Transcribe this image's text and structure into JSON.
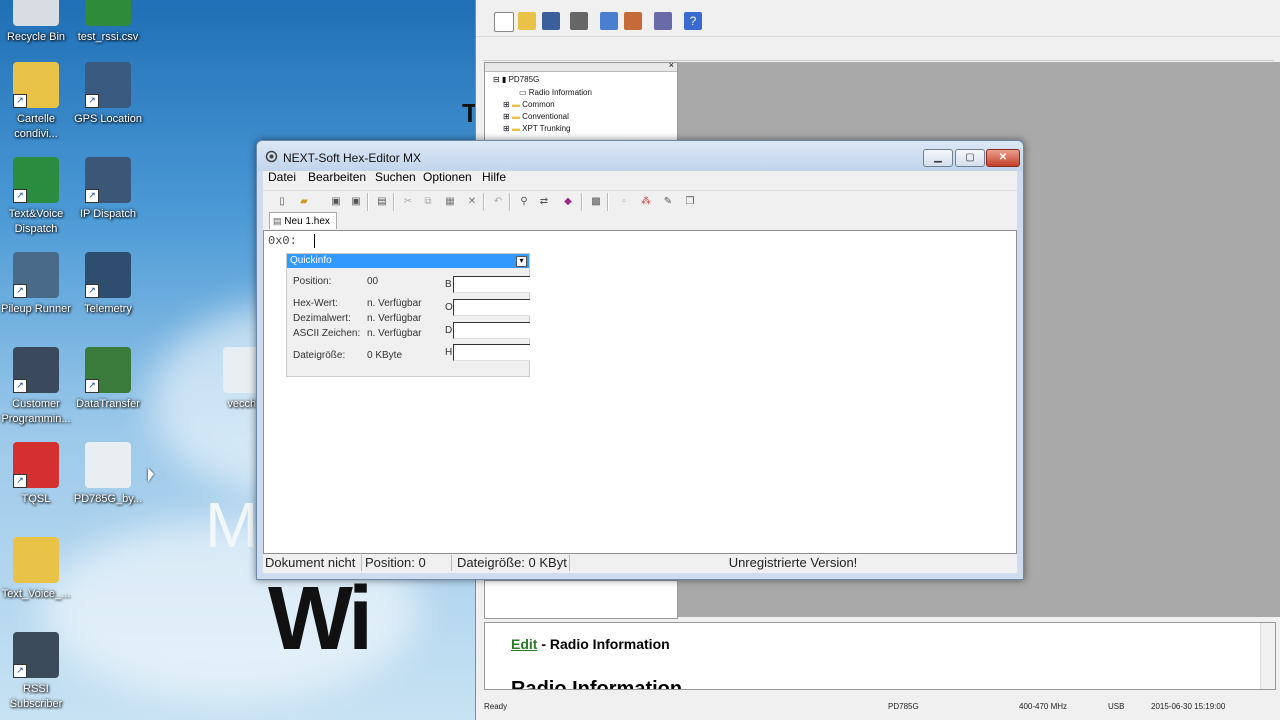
{
  "desktop": {
    "icons": [
      {
        "label": "Recycle Bin",
        "shortcut": false,
        "color": "#d8dde3"
      },
      {
        "label": "test_rssi.csv",
        "shortcut": false,
        "color": "#2e8b3a"
      },
      {
        "label": "Cartelle condivi...",
        "shortcut": true,
        "color": "#e9c347"
      },
      {
        "label": "GPS Location",
        "shortcut": true,
        "color": "#3a5a80"
      },
      {
        "label": "Text&Voice Dispatch",
        "shortcut": true,
        "color": "#2a8c3e"
      },
      {
        "label": "IP Dispatch",
        "shortcut": true,
        "color": "#3b5676"
      },
      {
        "label": "Pileup Runner",
        "shortcut": true,
        "color": "#4a6a8a"
      },
      {
        "label": "Telemetry",
        "shortcut": true,
        "color": "#2f4e6f"
      },
      {
        "label": "Customer Programmin...",
        "shortcut": true,
        "color": "#3a4a5c"
      },
      {
        "label": "DataTransfer",
        "shortcut": true,
        "color": "#3a7a3a"
      },
      {
        "label": "TQSL",
        "shortcut": true,
        "color": "#d43030"
      },
      {
        "label": "PD785G_by...",
        "shortcut": false,
        "color": "#e8eef2"
      },
      {
        "label": "Text_Voice_...",
        "shortcut": false,
        "color": "#e9c347"
      },
      {
        "label": "RSSI Subscriber",
        "shortcut": true,
        "color": "#3b4b5c"
      },
      {
        "label": "vecchia",
        "shortcut": false,
        "color": "#e8eef2"
      }
    ]
  },
  "back_app": {
    "tree": {
      "root": "PD785G",
      "items": [
        "Radio Information",
        "Common",
        "Conventional",
        "XPT Trunking"
      ]
    },
    "doc": {
      "link": "Edit",
      "heading_suffix": " - Radio Information",
      "big_heading": "Radio Information"
    },
    "status": {
      "ready": "Ready",
      "model": "PD785G",
      "band": "400-470 MHz",
      "port": "USB",
      "datetime": "2015-06-30 15:19:00"
    }
  },
  "hex_editor": {
    "title": "NEXT-Soft Hex-Editor MX",
    "menu": [
      "Datei",
      "Bearbeiten",
      "Suchen",
      "Optionen",
      "Hilfe"
    ],
    "tab": "Neu 1.hex",
    "address": "0x0:",
    "quickinfo": {
      "title": "Quickinfo",
      "position_label": "Position:",
      "position_value": "00",
      "hex_label": "Hex-Wert:",
      "hex_value": "n. Verfügbar",
      "dec_label": "Dezimalwert:",
      "dec_value": "n. Verfügbar",
      "ascii_label": "ASCII Zeichen:",
      "ascii_value": "n. Verfügbar",
      "size_label": "Dateigröße:",
      "size_value": "0 KByte",
      "side_letters": [
        "B",
        "O",
        "D",
        "H"
      ]
    },
    "status": {
      "doc": "Dokument nicht",
      "position": "Position: 0",
      "size": "Dateigröße: 0 KByt",
      "version": "Unregistrierte Version!"
    }
  }
}
